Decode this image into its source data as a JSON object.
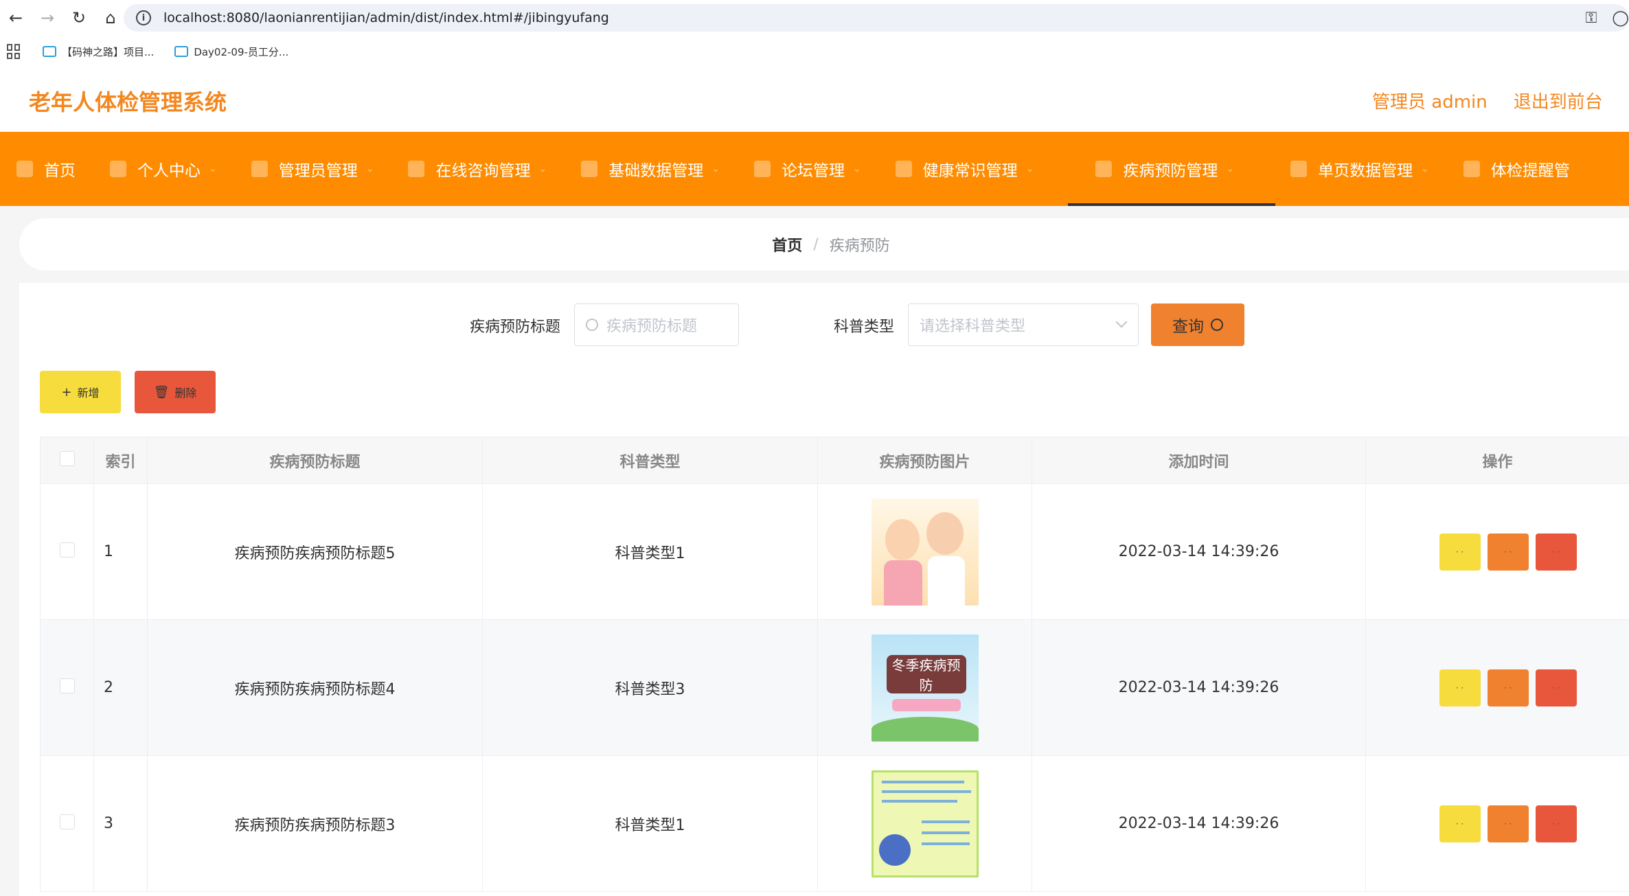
{
  "browser": {
    "url": "localhost:8080/laonianrentijian/admin/dist/index.html#/jibingyufang",
    "bookmarks": [
      "【码神之路】项目...",
      "Day02-09-员工分..."
    ]
  },
  "header": {
    "title": "老年人体检管理系统",
    "admin_label": "管理员 admin",
    "exit_front": "退出到前台",
    "exit_cut": "退"
  },
  "nav": {
    "items": [
      "首页",
      "个人中心",
      "管理员管理",
      "在线咨询管理",
      "基础数据管理",
      "论坛管理",
      "健康常识管理",
      "疾病预防管理",
      "单页数据管理",
      "体检提醒管"
    ],
    "active_index": 7
  },
  "breadcrumb": {
    "home": "首页",
    "sep": "/",
    "current": "疾病预防"
  },
  "search": {
    "title_label": "疾病预防标题",
    "title_placeholder": "疾病预防标题",
    "type_label": "科普类型",
    "type_placeholder": "请选择科普类型",
    "query_label": "查询"
  },
  "actions": {
    "add_label": "新增",
    "delete_label": "删除"
  },
  "table": {
    "columns": [
      "索引",
      "疾病预防标题",
      "科普类型",
      "疾病预防图片",
      "添加时间",
      "操作"
    ],
    "rows": [
      {
        "index": "1",
        "title": "疾病预防疾病预防标题5",
        "type": "科普类型1",
        "time": "2022-03-14 14:39:26"
      },
      {
        "index": "2",
        "title": "疾病预防疾病预防标题4",
        "type": "科普类型3",
        "time": "2022-03-14 14:39:26"
      },
      {
        "index": "3",
        "title": "疾病预防疾病预防标题3",
        "type": "科普类型1",
        "time": "2022-03-14 14:39:26"
      }
    ],
    "image2_text": "冬季疾病预防",
    "op_glyph": "· ·"
  },
  "colors": {
    "brand_orange": "#ff8c00",
    "title_orange": "#f3871f",
    "add_yellow": "#f7dc3d",
    "delete_red": "#e8573c",
    "query_orange": "#f0812f"
  }
}
